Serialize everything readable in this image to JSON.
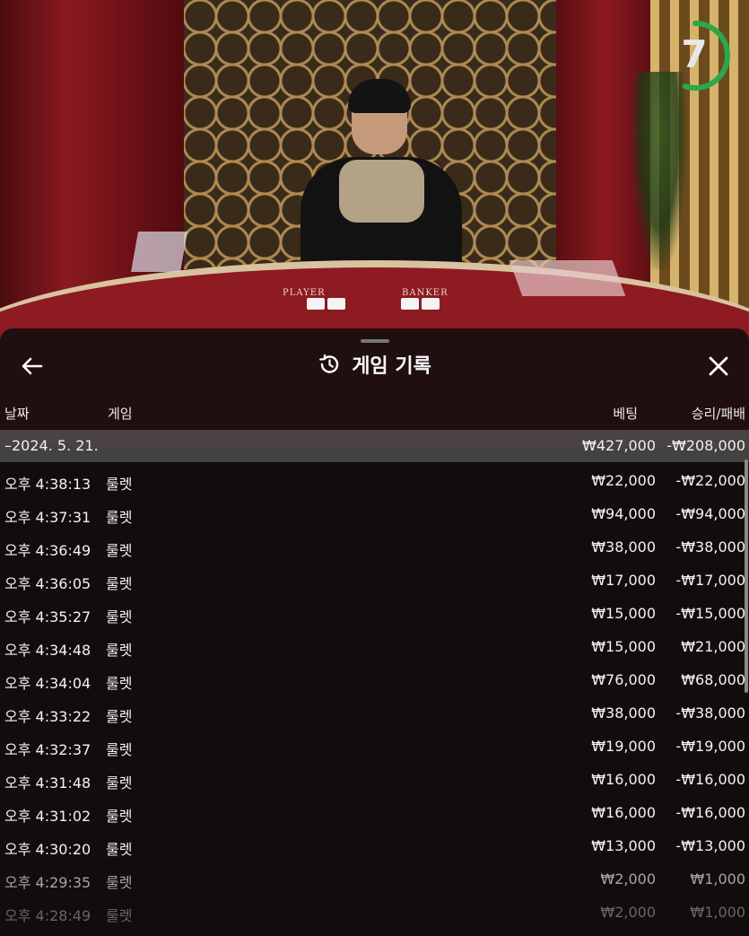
{
  "timer": {
    "value": "7",
    "fraction": 0.55,
    "color": "#2aa84a"
  },
  "table": {
    "player_label": "PLAYER",
    "banker_label": "BANKER"
  },
  "panel": {
    "title": "게임 기록",
    "icons": {
      "back": "arrow-left-icon",
      "close": "close-icon",
      "title": "history-icon"
    },
    "columns": {
      "date": "날짜",
      "game": "게임",
      "bet": "베팅",
      "winloss": "승리/패배"
    },
    "date_group": {
      "label": "–2024. 5. 21.",
      "bet": "₩427,000",
      "winloss": "-₩208,000"
    },
    "rows": [
      {
        "time": "오후 4:38:13",
        "game": "룰렛",
        "bet": "₩22,000",
        "winloss": "-₩22,000"
      },
      {
        "time": "오후 4:37:31",
        "game": "룰렛",
        "bet": "₩94,000",
        "winloss": "-₩94,000"
      },
      {
        "time": "오후 4:36:49",
        "game": "룰렛",
        "bet": "₩38,000",
        "winloss": "-₩38,000"
      },
      {
        "time": "오후 4:36:05",
        "game": "룰렛",
        "bet": "₩17,000",
        "winloss": "-₩17,000"
      },
      {
        "time": "오후 4:35:27",
        "game": "룰렛",
        "bet": "₩15,000",
        "winloss": "-₩15,000"
      },
      {
        "time": "오후 4:34:48",
        "game": "룰렛",
        "bet": "₩15,000",
        "winloss": "₩21,000"
      },
      {
        "time": "오후 4:34:04",
        "game": "룰렛",
        "bet": "₩76,000",
        "winloss": "₩68,000"
      },
      {
        "time": "오후 4:33:22",
        "game": "룰렛",
        "bet": "₩38,000",
        "winloss": "-₩38,000"
      },
      {
        "time": "오후 4:32:37",
        "game": "룰렛",
        "bet": "₩19,000",
        "winloss": "-₩19,000"
      },
      {
        "time": "오후 4:31:48",
        "game": "룰렛",
        "bet": "₩16,000",
        "winloss": "-₩16,000"
      },
      {
        "time": "오후 4:31:02",
        "game": "룰렛",
        "bet": "₩16,000",
        "winloss": "-₩16,000"
      },
      {
        "time": "오후 4:30:20",
        "game": "룰렛",
        "bet": "₩13,000",
        "winloss": "-₩13,000"
      },
      {
        "time": "오후 4:29:35",
        "game": "룰렛",
        "bet": "₩2,000",
        "winloss": "₩1,000"
      },
      {
        "time": "오후 4:28:49",
        "game": "룰렛",
        "bet": "₩2,000",
        "winloss": "₩1,000"
      }
    ]
  }
}
